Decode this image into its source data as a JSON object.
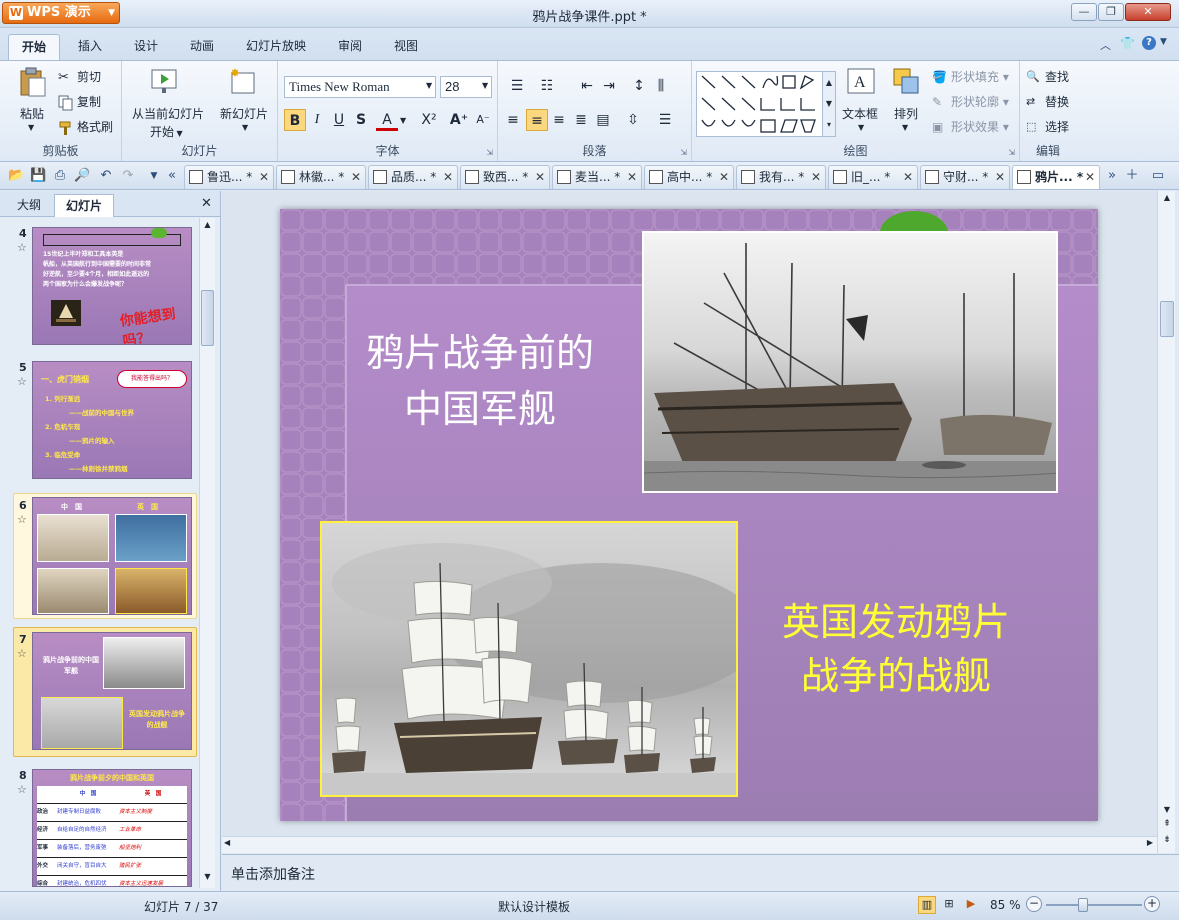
{
  "app": {
    "name": "WPS 演示",
    "logo": "W",
    "doc_title": "鸦片战争课件.ppt *"
  },
  "window_buttons": {
    "minimize": "—",
    "restore": "❐",
    "close": "✕"
  },
  "ribbon_tabs": [
    "开始",
    "插入",
    "设计",
    "动画",
    "幻灯片放映",
    "审阅",
    "视图"
  ],
  "ribbon": {
    "clipboard": {
      "label": "剪贴板",
      "paste": "粘贴",
      "cut": "剪切",
      "copy": "复制",
      "format_painter": "格式刷"
    },
    "slides": {
      "label": "幻灯片",
      "from_current": "从当前幻灯片",
      "start": "开始",
      "new_slide": "新幻灯片"
    },
    "font": {
      "label": "字体",
      "font_name": "Times New Roman",
      "font_size": "28",
      "bold": "B",
      "italic": "I",
      "underline": "U",
      "strike": "S"
    },
    "paragraph": {
      "label": "段落"
    },
    "drawing": {
      "label": "绘图",
      "textbox": "文本框",
      "arrange": "排列",
      "shape_fill": "形状填充",
      "shape_outline": "形状轮廓",
      "shape_effect": "形状效果"
    },
    "edit": {
      "label": "编辑",
      "find": "查找",
      "replace": "替换",
      "select": "选择"
    }
  },
  "doc_tabs": [
    "鲁迅... *",
    "林徽... *",
    "品质... *",
    "致西... *",
    "麦当... *",
    "高中... *",
    "我有... *",
    "旧_... *",
    "守财... *",
    "鸦片... *"
  ],
  "left_panel": {
    "tab_outline": "大纲",
    "tab_slides": "幻灯片"
  },
  "thumbnails": [
    {
      "num": "4",
      "lines": [
        "15世纪上半叶郑和工具本英是",
        "帆船，从英国航行到中国需要的时间非常",
        "好逆航，至少要4个月，相距如此遥远的",
        "两个国家为什么会爆发战争呢？"
      ],
      "callout": "你能想到吗？"
    },
    {
      "num": "5",
      "title": "一、虎门销烟",
      "bubble": "我能答得出吗？",
      "items": [
        "1. 列行渐远",
        "——战前的中国与世界",
        "2. 危机乍现",
        "——鸦片的输入",
        "3. 临危受命",
        "——林则徐并禁鸦烟"
      ]
    },
    {
      "num": "6",
      "head_left": "中　国",
      "head_right": "英　国"
    },
    {
      "num": "7",
      "text1": "鸦片战争前的中国军舰",
      "text2": "英国发动鸦片战争的战舰"
    },
    {
      "num": "8",
      "title": "鸦片战争前夕的中国和英国",
      "col_cn": "中　国",
      "col_en": "英　国",
      "rows": [
        {
          "k": "政治",
          "cn": "封建专制日益腐败",
          "en": "资本主义制度"
        },
        {
          "k": "经济",
          "cn": "自给自足的自然经济",
          "en": "工业革命"
        },
        {
          "k": "军事",
          "cn": "装备落后，营务废弛",
          "en": "船坚炮利"
        },
        {
          "k": "外交",
          "cn": "闭关自守，盲目自大",
          "en": "殖民扩张"
        },
        {
          "k": "综合",
          "cn": "封建统治，危机四伏",
          "en": "资本主义迅速发展"
        }
      ]
    }
  ],
  "slide": {
    "text_left": "鸦片战争前的\n中国军舰",
    "text_right": "英国发动鸦片\n战争的战舰"
  },
  "notes_placeholder": "单击添加备注",
  "status": {
    "slide_pos": "幻灯片 7 / 37",
    "template": "默认设计模板",
    "zoom": "85 %"
  },
  "colors": {
    "slide_bg": "#a07ab8",
    "text_white": "#ffffff",
    "text_yellow": "#ffff33",
    "accent_orange": "#e66a10"
  }
}
